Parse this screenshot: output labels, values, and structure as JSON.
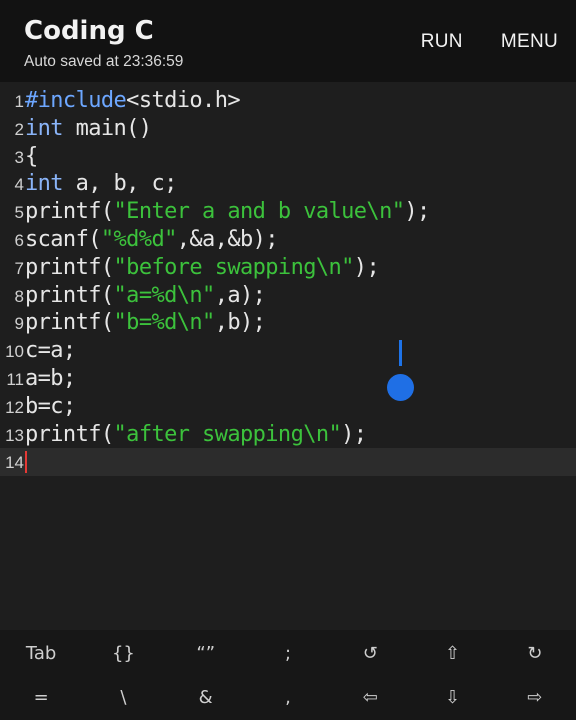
{
  "appbar": {
    "title": "Coding C",
    "subtitle": "Auto saved at 23:36:59",
    "run_label": "RUN",
    "menu_label": "MENU"
  },
  "editor": {
    "lines": [
      {
        "n": "1",
        "parts": [
          {
            "t": "#include",
            "c": "pre"
          },
          {
            "t": "<stdio.h>",
            "c": ""
          }
        ]
      },
      {
        "n": "2",
        "parts": [
          {
            "t": "int",
            "c": "kw"
          },
          {
            "t": " main()",
            "c": ""
          }
        ]
      },
      {
        "n": "3",
        "parts": [
          {
            "t": "{",
            "c": ""
          }
        ]
      },
      {
        "n": "4",
        "parts": [
          {
            "t": "int",
            "c": "kw"
          },
          {
            "t": " a, b, c;",
            "c": ""
          }
        ]
      },
      {
        "n": "5",
        "parts": [
          {
            "t": "printf(",
            "c": ""
          },
          {
            "t": "\"Enter a and b value\\n\"",
            "c": "str"
          },
          {
            "t": ");",
            "c": ""
          }
        ]
      },
      {
        "n": "6",
        "parts": [
          {
            "t": "scanf(",
            "c": ""
          },
          {
            "t": "\"%d%d\"",
            "c": "str"
          },
          {
            "t": ",&a,&b);",
            "c": ""
          }
        ]
      },
      {
        "n": "7",
        "parts": [
          {
            "t": "printf(",
            "c": ""
          },
          {
            "t": "\"before swapping\\n\"",
            "c": "str"
          },
          {
            "t": ");",
            "c": ""
          }
        ]
      },
      {
        "n": "8",
        "parts": [
          {
            "t": "printf(",
            "c": ""
          },
          {
            "t": "\"a=%d\\n\"",
            "c": "str"
          },
          {
            "t": ",a);",
            "c": ""
          }
        ]
      },
      {
        "n": "9",
        "parts": [
          {
            "t": "printf(",
            "c": ""
          },
          {
            "t": "\"b=%d\\n\"",
            "c": "str"
          },
          {
            "t": ",b);",
            "c": ""
          }
        ]
      },
      {
        "n": "10",
        "parts": [
          {
            "t": "c=a;",
            "c": ""
          }
        ]
      },
      {
        "n": "11",
        "parts": [
          {
            "t": "a=b;",
            "c": ""
          }
        ]
      },
      {
        "n": "12",
        "parts": [
          {
            "t": "b=c;",
            "c": ""
          }
        ]
      },
      {
        "n": "13",
        "parts": [
          {
            "t": "printf(",
            "c": ""
          },
          {
            "t": "\"after swapping\\n\"",
            "c": "str"
          },
          {
            "t": ");",
            "c": ""
          }
        ]
      },
      {
        "n": "14",
        "parts": []
      }
    ],
    "current_line": 14
  },
  "keybar": {
    "row1": [
      {
        "label": "Tab",
        "icon": "tab-key"
      },
      {
        "label": "{}",
        "icon": "braces-key"
      },
      {
        "label": "“”",
        "icon": "quotes-key"
      },
      {
        "label": ";",
        "icon": "semicolon-key"
      },
      {
        "label": "↺",
        "icon": "undo-icon"
      },
      {
        "label": "⇧",
        "icon": "arrow-up-icon"
      },
      {
        "label": "↻",
        "icon": "redo-icon"
      }
    ],
    "row2": [
      {
        "label": "=",
        "icon": "equals-key"
      },
      {
        "label": "\\",
        "icon": "backslash-key"
      },
      {
        "label": "&",
        "icon": "ampersand-key"
      },
      {
        "label": ",",
        "icon": "comma-key"
      },
      {
        "label": "⇦",
        "icon": "arrow-left-icon"
      },
      {
        "label": "⇩",
        "icon": "arrow-down-icon"
      },
      {
        "label": "⇨",
        "icon": "arrow-right-icon"
      }
    ]
  }
}
